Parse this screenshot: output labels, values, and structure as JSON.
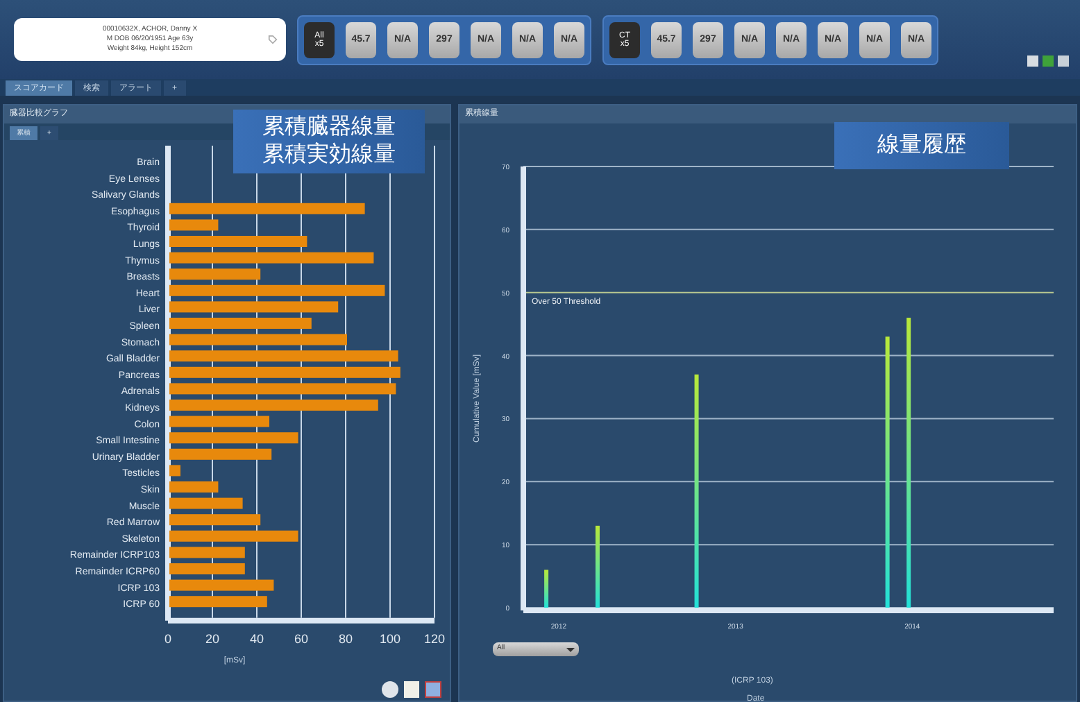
{
  "patient": {
    "lines": [
      "00010632X, ACHOR, Danny X",
      "M DOB 06/20/1951 Age 63y",
      "Weight 84kg, Height 152cm"
    ]
  },
  "tile_groups": [
    {
      "label": "All",
      "count": "x5",
      "tiles": [
        "45.7",
        "N/A",
        "297",
        "N/A",
        "N/A",
        "N/A"
      ]
    },
    {
      "label": "CT",
      "count": "x5",
      "tiles": [
        "45.7",
        "297",
        "N/A",
        "N/A",
        "N/A",
        "N/A",
        "N/A"
      ]
    }
  ],
  "tabs": [
    {
      "label": "スコアカード",
      "selected": true
    },
    {
      "label": "検索",
      "selected": false
    },
    {
      "label": "アラート",
      "selected": false
    },
    {
      "label": "+",
      "selected": false
    }
  ],
  "left_panel": {
    "title": "臓器比較グラフ",
    "subtabs": [
      {
        "label": "累積",
        "selected": true
      },
      {
        "label": "+",
        "selected": false
      }
    ],
    "callout": [
      "累積臓器線量",
      "累積実効線量"
    ],
    "chart_data": {
      "type": "bar",
      "orientation": "horizontal",
      "xlabel": "[mSv]",
      "categories": [
        "Brain",
        "Eye Lenses",
        "Salivary Glands",
        "Esophagus",
        "Thyroid",
        "Lungs",
        "Thymus",
        "Breasts",
        "Heart",
        "Liver",
        "Spleen",
        "Stomach",
        "Gall Bladder",
        "Pancreas",
        "Adrenals",
        "Kidneys",
        "Colon",
        "Small Intestine",
        "Urinary Bladder",
        "Testicles",
        "Skin",
        "Muscle",
        "Red Marrow",
        "Skeleton",
        "Remainder ICRP103",
        "Remainder ICRP60",
        "ICRP 103",
        "ICRP 60"
      ],
      "grid": true,
      "series": [
        {
          "color": "#e8890c",
          "values": [
            0,
            0,
            0,
            88,
            22,
            62,
            92,
            41,
            97,
            76,
            64,
            80,
            103,
            104,
            102,
            94,
            45,
            58,
            46,
            5,
            22,
            33,
            41,
            58,
            34,
            34,
            47,
            44
          ]
        }
      ],
      "xlim": [
        0,
        120
      ],
      "xticks": [
        0,
        20,
        40,
        60,
        80,
        100,
        120
      ]
    }
  },
  "right_panel": {
    "title": "累積線量",
    "callout": "線量履歴",
    "filter": "All",
    "subtitle": "(ICRP 103)",
    "chart_data": {
      "type": "bar",
      "xlabel": "Date",
      "ylabel": "Cumulative Value [mSv]",
      "x": [
        2011.93,
        2012.22,
        2012.78,
        2013.86,
        2013.98
      ],
      "grid": true,
      "series": [
        {
          "color": "#b8e83a",
          "values": [
            6,
            13,
            37,
            43,
            46
          ]
        }
      ],
      "xlim": [
        2011.8,
        2014.8
      ],
      "ylim": [
        0,
        70
      ],
      "xticks": [
        {
          "value": 2012,
          "label": "2012"
        },
        {
          "value": 2013,
          "label": "2013"
        },
        {
          "value": 2014,
          "label": "2014"
        }
      ],
      "yticks": [
        0,
        10,
        20,
        30,
        40,
        50,
        60,
        70
      ],
      "ref_lines": [
        {
          "axis": "y",
          "value": 50,
          "color": "#b8c890",
          "label": "Over 50 Threshold"
        }
      ]
    }
  }
}
